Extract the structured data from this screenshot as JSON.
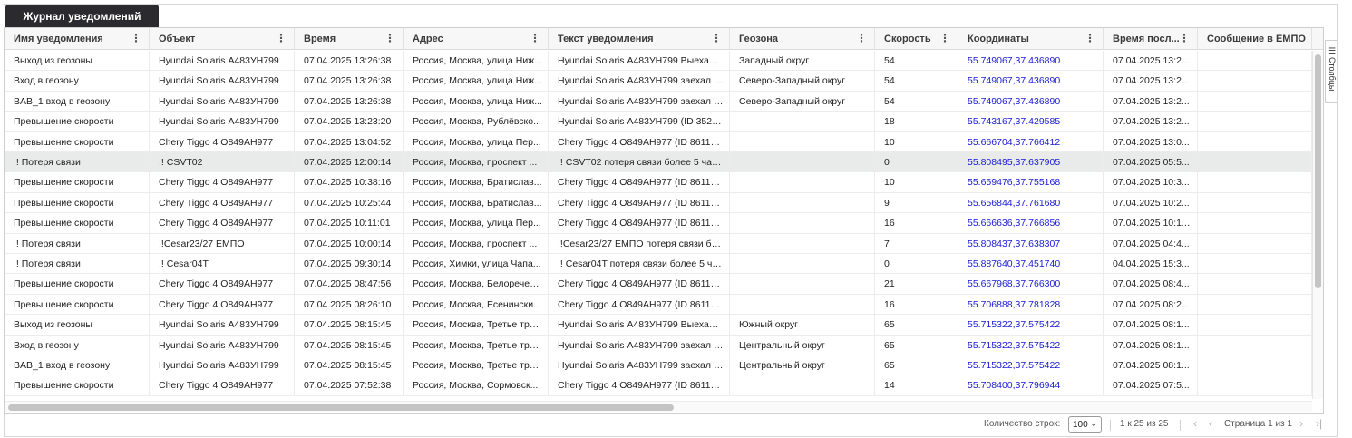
{
  "tab": {
    "label": "Журнал уведомлений"
  },
  "columns": [
    "Имя уведомления",
    "Объект",
    "Время",
    "Адрес",
    "Текст уведомления",
    "Геозона",
    "Скорость",
    "Координаты",
    "Время посл...",
    "Сообщение в ЕМПО"
  ],
  "rows": [
    [
      "Выход из геозоны",
      "Hyundai Solaris А483УН799",
      "07.04.2025 13:26:38",
      "Россия, Москва, улица Ниж...",
      "Hyundai Solaris А483УН799 Выехал ...",
      "Западный округ",
      "54",
      "55.749067,37.436890",
      "07.04.2025 13:2...",
      ""
    ],
    [
      "Вход в геозону",
      "Hyundai Solaris А483УН799",
      "07.04.2025 13:26:38",
      "Россия, Москва, улица Ниж...",
      "Hyundai Solaris А483УН799 заехал в...",
      "Северо-Западный округ",
      "54",
      "55.749067,37.436890",
      "07.04.2025 13:2...",
      ""
    ],
    [
      "BAB_1 вход в геозону",
      "Hyundai Solaris А483УН799",
      "07.04.2025 13:26:38",
      "Россия, Москва, улица Ниж...",
      "Hyundai Solaris А483УН799 заехал в...",
      "Северо-Западный округ",
      "54",
      "55.749067,37.436890",
      "07.04.2025 13:2...",
      ""
    ],
    [
      "Превышение скорости",
      "Hyundai Solaris А483УН799",
      "07.04.2025 13:23:20",
      "Россия, Москва, Рублёвско...",
      "Hyundai Solaris А483УН799 (ID 3520...",
      "",
      "18",
      "55.743167,37.429585",
      "07.04.2025 13:2...",
      ""
    ],
    [
      "Превышение скорости",
      "Chery Tiggo 4 О849АН977",
      "07.04.2025 13:04:52",
      "Россия, Москва, улица Пер...",
      "Chery Tiggo 4 О849АН977 (ID 86110...",
      "",
      "10",
      "55.666704,37.766412",
      "07.04.2025 13:0...",
      ""
    ],
    [
      "!! Потеря связи",
      "!! CSVT02",
      "07.04.2025 12:00:14",
      "Россия, Москва, проспект ...",
      "!! CSVT02 потеря связи более 5 час...",
      "",
      "0",
      "55.808495,37.637905",
      "07.04.2025 05:5...",
      ""
    ],
    [
      "Превышение скорости",
      "Chery Tiggo 4 О849АН977",
      "07.04.2025 10:38:16",
      "Россия, Москва, Братислав...",
      "Chery Tiggo 4 О849АН977 (ID 86110...",
      "",
      "10",
      "55.659476,37.755168",
      "07.04.2025 10:3...",
      ""
    ],
    [
      "Превышение скорости",
      "Chery Tiggo 4 О849АН977",
      "07.04.2025 10:25:44",
      "Россия, Москва, Братислав...",
      "Chery Tiggo 4 О849АН977 (ID 86110...",
      "",
      "9",
      "55.656844,37.761680",
      "07.04.2025 10:2...",
      ""
    ],
    [
      "Превышение скорости",
      "Chery Tiggo 4 О849АН977",
      "07.04.2025 10:11:01",
      "Россия, Москва, улица Пер...",
      "Chery Tiggo 4 О849АН977 (ID 86110...",
      "",
      "16",
      "55.666636,37.766856",
      "07.04.2025 10:11...",
      ""
    ],
    [
      "!! Потеря связи",
      "!!Cesar23/27 ЕМПО",
      "07.04.2025 10:00:14",
      "Россия, Москва, проспект ...",
      "!!Cesar23/27 ЕМПО потеря связи бо...",
      "",
      "7",
      "55.808437,37.638307",
      "07.04.2025 04:4...",
      ""
    ],
    [
      "!! Потеря связи",
      "!! Cesar04T",
      "07.04.2025 09:30:14",
      "Россия, Химки, улица Чапа...",
      "!! Cesar04T потеря связи более 5 час...",
      "",
      "0",
      "55.887640,37.451740",
      "04.04.2025 15:3...",
      ""
    ],
    [
      "Превышение скорости",
      "Chery Tiggo 4 О849АН977",
      "07.04.2025 08:47:56",
      "Россия, Москва, Белоречен...",
      "Chery Tiggo 4 О849АН977 (ID 86110...",
      "",
      "21",
      "55.667968,37.766300",
      "07.04.2025 08:4...",
      ""
    ],
    [
      "Превышение скорости",
      "Chery Tiggo 4 О849АН977",
      "07.04.2025 08:26:10",
      "Россия, Москва, Есенински...",
      "Chery Tiggo 4 О849АН977 (ID 86110...",
      "",
      "16",
      "55.706888,37.781828",
      "07.04.2025 08:2...",
      ""
    ],
    [
      "Выход из геозоны",
      "Hyundai Solaris А483УН799",
      "07.04.2025 08:15:45",
      "Россия, Москва, Третье тра...",
      "Hyundai Solaris А483УН799 Выехал ...",
      "Южный округ",
      "65",
      "55.715322,37.575422",
      "07.04.2025 08:1...",
      ""
    ],
    [
      "Вход в геозону",
      "Hyundai Solaris А483УН799",
      "07.04.2025 08:15:45",
      "Россия, Москва, Третье тра...",
      "Hyundai Solaris А483УН799 заехал в...",
      "Центральный округ",
      "65",
      "55.715322,37.575422",
      "07.04.2025 08:1...",
      ""
    ],
    [
      "BAB_1 вход в геозону",
      "Hyundai Solaris А483УН799",
      "07.04.2025 08:15:45",
      "Россия, Москва, Третье тра...",
      "Hyundai Solaris А483УН799 заехал в...",
      "Центральный округ",
      "65",
      "55.715322,37.575422",
      "07.04.2025 08:1...",
      ""
    ],
    [
      "Превышение скорости",
      "Chery Tiggo 4 О849АН977",
      "07.04.2025 07:52:38",
      "Россия, Москва, Сормовск...",
      "Chery Tiggo 4 О849АН977 (ID 86110...",
      "",
      "14",
      "55.708400,37.796944",
      "07.04.2025 07:5...",
      ""
    ]
  ],
  "selected_row": 5,
  "side_panel": {
    "label": "Столбцы"
  },
  "footer": {
    "rows_label": "Количество строк:",
    "rows_value": "100",
    "range": "1 к 25 из 25",
    "page": "Страница 1 из 1"
  },
  "colors": {
    "tab_bg": "#2b2b2f",
    "link": "#1a1ad6",
    "selected_row": "#e9eaea"
  }
}
